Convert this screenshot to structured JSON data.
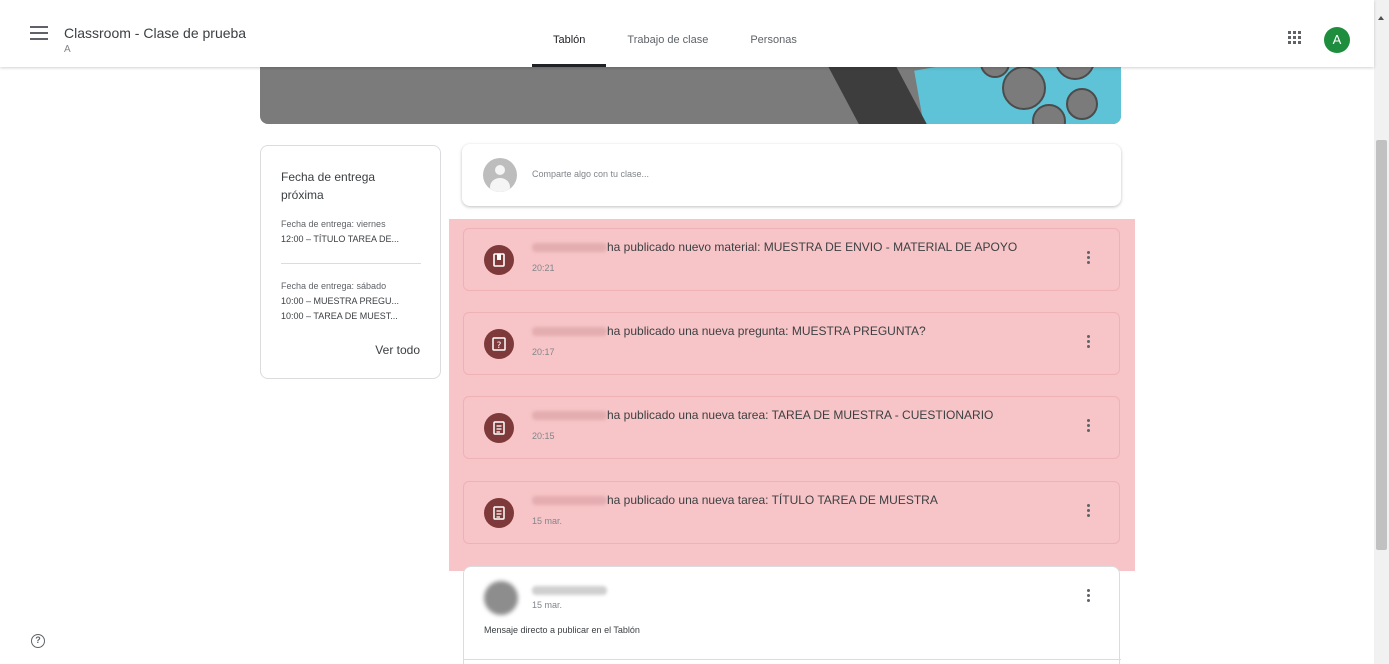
{
  "header": {
    "title": "Classroom - Clase de prueba",
    "subtitle": "A",
    "tabs": [
      {
        "label": "Tablón",
        "active": true
      },
      {
        "label": "Trabajo de clase",
        "active": false
      },
      {
        "label": "Personas",
        "active": false
      }
    ],
    "avatar_letter": "A"
  },
  "upcoming": {
    "title": "Fecha de entrega próxima",
    "groups": [
      {
        "due": "Fecha de entrega: viernes",
        "items": [
          "12:00 – TÍTULO TAREA DE..."
        ]
      },
      {
        "due": "Fecha de entrega: sábado",
        "items": [
          "10:00 – MUESTRA PREGU...",
          "10:00 – TAREA DE MUEST..."
        ]
      }
    ],
    "view_all": "Ver todo"
  },
  "compose": {
    "placeholder": "Comparte algo con tu clase..."
  },
  "posts": [
    {
      "icon": "material-icon",
      "text": "ha publicado nuevo material: MUESTRA DE ENVIO - MATERIAL DE APOYO",
      "time": "20:21"
    },
    {
      "icon": "question-icon",
      "text": "ha publicado una nueva pregunta: MUESTRA PREGUNTA?",
      "time": "20:17"
    },
    {
      "icon": "assignment-icon",
      "text": "ha publicado una nueva tarea: TAREA DE MUESTRA - CUESTIONARIO",
      "time": "20:15"
    },
    {
      "icon": "assignment-icon",
      "text": "ha publicado una nueva tarea: TÍTULO TAREA DE MUESTRA",
      "time": "15 mar."
    }
  ],
  "announcement": {
    "time": "15 mar.",
    "text": "Mensaje directo a publicar en el Tablón"
  },
  "colors": {
    "highlight": "#f7c5c7",
    "post_icon_bg": "#7e3a3b",
    "avatar_green": "#1e8e3e"
  }
}
